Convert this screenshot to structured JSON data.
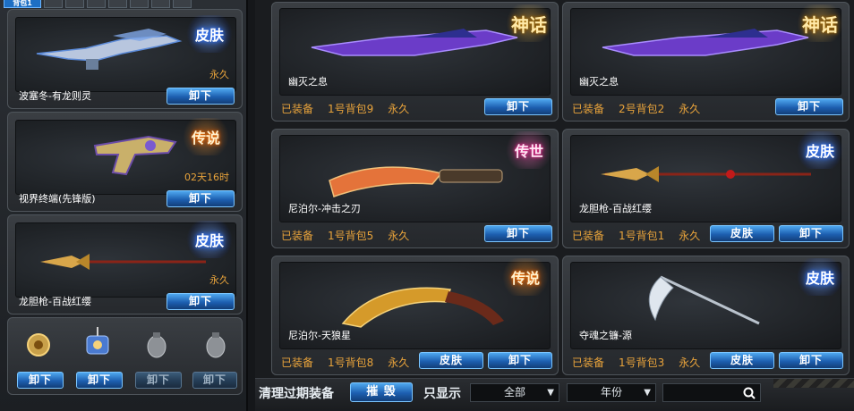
{
  "bag_tabs": [
    {
      "label": "背包1",
      "active": true
    },
    {
      "label": "",
      "active": false
    },
    {
      "label": "",
      "active": false
    },
    {
      "label": "",
      "active": false
    },
    {
      "label": "",
      "active": false
    },
    {
      "label": "",
      "active": false
    },
    {
      "label": "",
      "active": false
    },
    {
      "label": "",
      "active": false
    },
    {
      "label": "",
      "active": false
    }
  ],
  "left_cards": [
    {
      "name": "波塞冬-有龙则灵",
      "duration": "永久",
      "badge": "皮肤",
      "button": "卸下"
    },
    {
      "name": "视界终端(先锋版)",
      "duration": "02天16时",
      "badge": "传说",
      "button": "卸下"
    },
    {
      "name": "龙胆枪-百战红缨",
      "duration": "永久",
      "badge": "皮肤",
      "button": "卸下"
    }
  ],
  "item_slots": [
    {
      "icon": "grenade-gold-icon",
      "button": "卸下",
      "enabled": true
    },
    {
      "icon": "drone-device-icon",
      "button": "卸下",
      "enabled": true
    },
    {
      "icon": "grenade-grey-icon",
      "button": "卸下",
      "enabled": false
    },
    {
      "icon": "grenade-grey-icon",
      "button": "卸下",
      "enabled": false
    }
  ],
  "right_cards": [
    {
      "name": "幽灭之息",
      "equipped": "已装备",
      "bag": "1号背包9",
      "duration": "永久",
      "badge": "神话",
      "skin_button": "",
      "unequip_button": "卸下"
    },
    {
      "name": "幽灭之息",
      "equipped": "已装备",
      "bag": "2号背包2",
      "duration": "永久",
      "badge": "神话",
      "skin_button": "",
      "unequip_button": "卸下"
    },
    {
      "name": "尼泊尔-冲击之刃",
      "equipped": "已装备",
      "bag": "1号背包5",
      "duration": "永久",
      "badge": "传世",
      "skin_button": "",
      "unequip_button": "卸下"
    },
    {
      "name": "龙胆枪-百战红缨",
      "equipped": "已装备",
      "bag": "1号背包1",
      "duration": "永久",
      "badge": "皮肤",
      "skin_button": "皮肤",
      "unequip_button": "卸下"
    },
    {
      "name": "尼泊尔-天狼星",
      "equipped": "已装备",
      "bag": "1号背包8",
      "duration": "永久",
      "badge": "传说",
      "skin_button": "皮肤",
      "unequip_button": "卸下"
    },
    {
      "name": "夺魂之镰-源",
      "equipped": "已装备",
      "bag": "1号背包3",
      "duration": "永久",
      "badge": "皮肤",
      "skin_button": "皮肤",
      "unequip_button": "卸下"
    }
  ],
  "bottom_bar": {
    "clear_label": "清理过期装备",
    "destroy_button": "摧 毁",
    "filter_label": "只显示",
    "filter_select": "全部",
    "year_select": "年份",
    "search_value": ""
  },
  "colors": {
    "accent_blue": "#1d5fb0",
    "duration_orange": "#e8a33b"
  }
}
